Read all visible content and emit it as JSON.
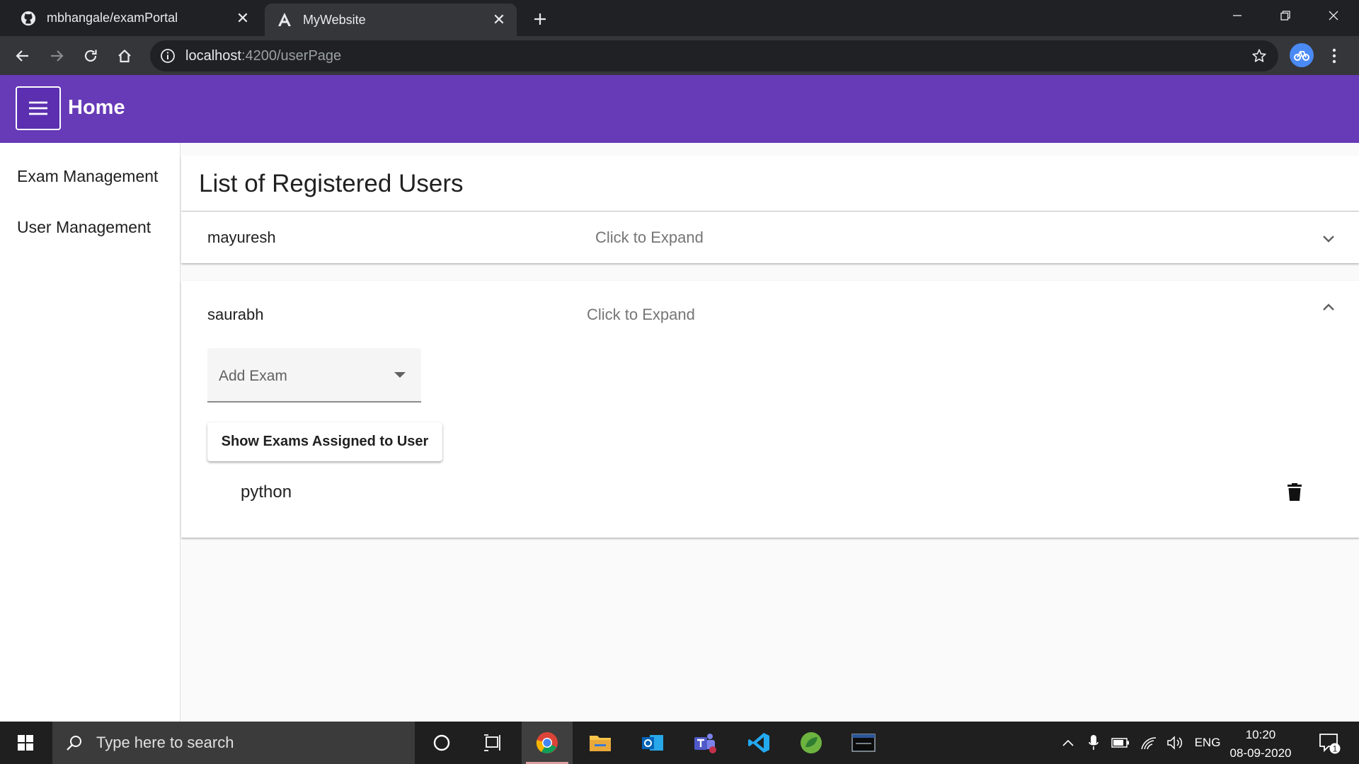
{
  "browser": {
    "tabs": [
      {
        "title": "mbhangale/examPortal",
        "favicon": "github-icon",
        "active": false
      },
      {
        "title": "MyWebsite",
        "favicon": "angular-icon",
        "active": true
      }
    ],
    "url_host": "localhost",
    "url_path": ":4200/userPage"
  },
  "app": {
    "header_title": "Home",
    "sidebar": {
      "items": [
        {
          "label": "Exam Management"
        },
        {
          "label": "User Management"
        }
      ]
    },
    "page_title": "List of Registered Users",
    "users": [
      {
        "name": "mayuresh",
        "description": "Click to Expand",
        "expanded": false
      },
      {
        "name": "saurabh",
        "description": "Click to Expand",
        "expanded": true,
        "add_exam_label": "Add Exam",
        "show_exams_button": "Show Exams Assigned to User",
        "exams": [
          {
            "name": "python"
          }
        ]
      }
    ]
  },
  "taskbar": {
    "search_placeholder": "Type here to search",
    "language": "ENG",
    "time": "10:20",
    "date": "08-09-2020",
    "notification_count": "1"
  },
  "colors": {
    "primary": "#673ab7",
    "browser_dark": "#202124",
    "browser_toolbar": "#35363a"
  }
}
